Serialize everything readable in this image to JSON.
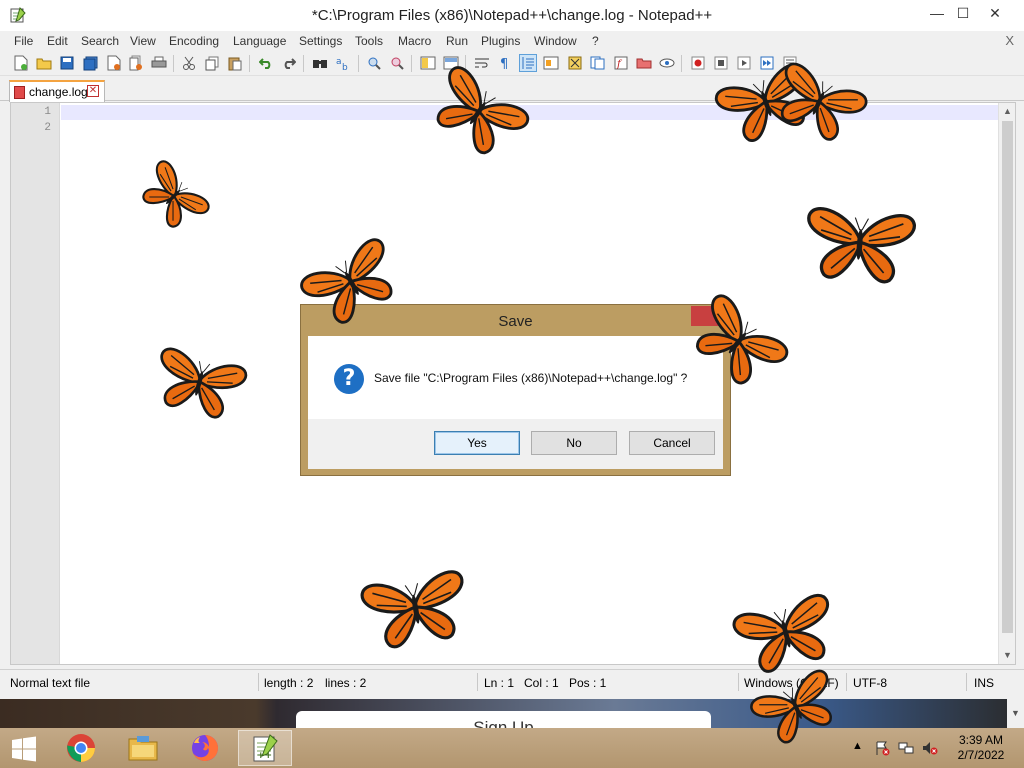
{
  "window": {
    "title": "*C:\\Program Files (x86)\\Notepad++\\change.log - Notepad++",
    "minimize": "—",
    "maximize": "☐",
    "close": "✕"
  },
  "menu": {
    "items": [
      "File",
      "Edit",
      "Search",
      "View",
      "Encoding",
      "Language",
      "Settings",
      "Tools",
      "Macro",
      "Run",
      "Plugins",
      "Window",
      "?"
    ],
    "close": "X"
  },
  "tabs": [
    {
      "label": "change.log",
      "close": "✕"
    }
  ],
  "editor": {
    "line_numbers": [
      "1",
      "2"
    ]
  },
  "status": {
    "file_type": "Normal text file",
    "length": "length : 2",
    "lines": "lines : 2",
    "ln": "Ln : 1",
    "col": "Col : 1",
    "pos": "Pos : 1",
    "eol": "Windows (CR LF)",
    "encoding": "UTF-8",
    "mode": "INS"
  },
  "background": {
    "signup": "Sign Up"
  },
  "dialog": {
    "title": "Save",
    "message": "Save file \"C:\\Program Files (x86)\\Notepad++\\change.log\" ?",
    "icon": "?",
    "yes": "Yes",
    "no": "No",
    "cancel": "Cancel"
  },
  "taskbar": {
    "time": "3:39 AM",
    "date": "2/7/2022",
    "tray_arrow": "▲"
  },
  "colors": {
    "butterfly_orange": "#f07818",
    "butterfly_black": "#1a1a1a",
    "dialog_frame": "#bc9d62",
    "taskbar": "#b99e78"
  }
}
